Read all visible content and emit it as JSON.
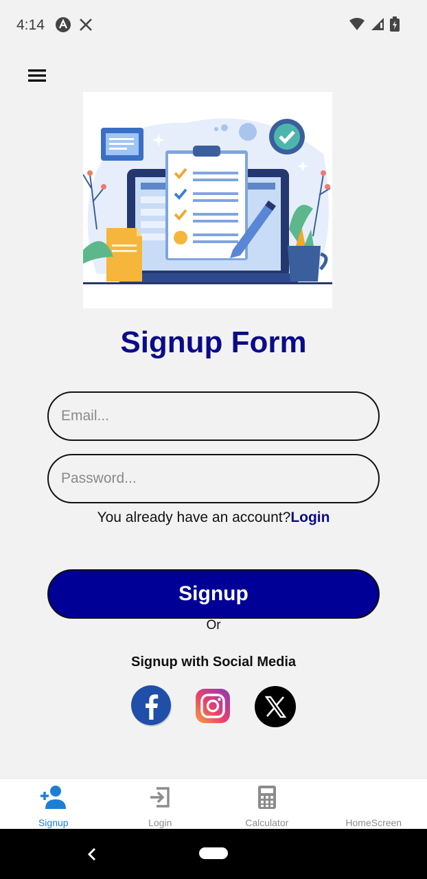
{
  "status_bar": {
    "time": "4:14",
    "left_icons": [
      "app-a-icon",
      "x-logo-icon"
    ],
    "right_icons": [
      "wifi-icon",
      "signal-icon",
      "battery-icon"
    ]
  },
  "form": {
    "title": "Signup Form",
    "email_placeholder": "Email...",
    "password_placeholder": "Password...",
    "account_prompt": "You already have an account?",
    "login_link": "Login",
    "signup_button": "Signup",
    "or_text": "Or",
    "social_title": "Signup with Social Media",
    "social_icons": [
      "facebook-icon",
      "instagram-icon",
      "x-icon"
    ]
  },
  "bottom_nav": {
    "items": [
      {
        "label": "Signup",
        "icon": "add-user-icon",
        "active": true
      },
      {
        "label": "Login",
        "icon": "login-icon",
        "active": false
      },
      {
        "label": "Calculator",
        "icon": "calculator-icon",
        "active": false
      },
      {
        "label": "HomeScreen",
        "icon": "home-icon",
        "active": false
      }
    ]
  },
  "colors": {
    "primary": "#000096",
    "title": "#0b0b8a",
    "active_nav": "#1b7fd6",
    "background": "#f2f2f2"
  }
}
